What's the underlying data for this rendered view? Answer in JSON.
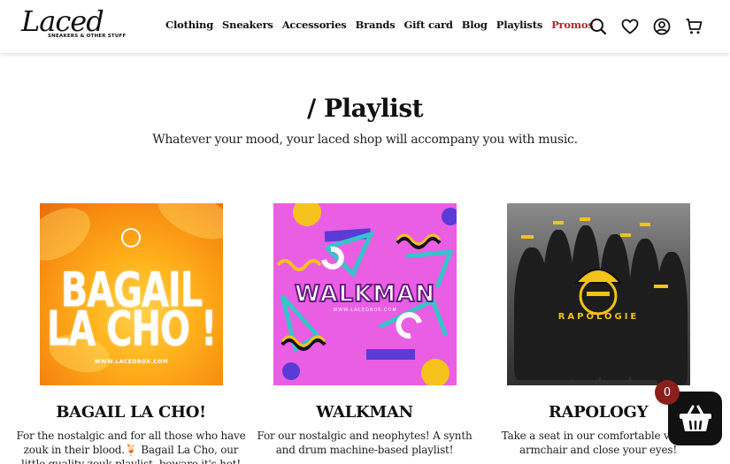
{
  "brand": {
    "logo_text": "Laced",
    "logo_tagline": "SNEAKERS & OTHER STUFF"
  },
  "nav": {
    "items": [
      {
        "label": "Clothing"
      },
      {
        "label": "Sneakers"
      },
      {
        "label": "Accessories"
      },
      {
        "label": "Brands"
      },
      {
        "label": "Gift card"
      },
      {
        "label": "Blog"
      },
      {
        "label": "Playlists"
      },
      {
        "label": "Promos",
        "highlight": true
      }
    ],
    "promo_color": "#b3262b"
  },
  "header_icons": [
    "search-icon",
    "heart-icon",
    "account-icon",
    "cart-icon"
  ],
  "page": {
    "title": "/ Playlist",
    "subtitle": "Whatever your mood, your laced shop will accompany you with music."
  },
  "playlists": [
    {
      "cover_title_line1": "BAGAIL",
      "cover_title_line2": "LA CHO !",
      "cover_url": "WWW.LACEDBOX.COM",
      "title": "BAGAIL LA CHO!",
      "description": "For the nostalgic and for all those who have zouk in their blood.🍹 Bagail La Cho, our little quality zouk playlist, beware it's hot! 🔥"
    },
    {
      "cover_title": "WALKMAN",
      "cover_url": "WWW.LACEDBOX.COM",
      "title": "WALKMAN",
      "description": "For our nostalgic and neophytes! A synth and drum machine-based playlist!"
    },
    {
      "cover_title": "RAPOLOGIE",
      "title": "RAPOLOGY",
      "description": "Take a seat in our comfortable velvet armchair and close your eyes!"
    }
  ],
  "cart": {
    "count": "0",
    "badge_color": "#8b1f1c"
  }
}
